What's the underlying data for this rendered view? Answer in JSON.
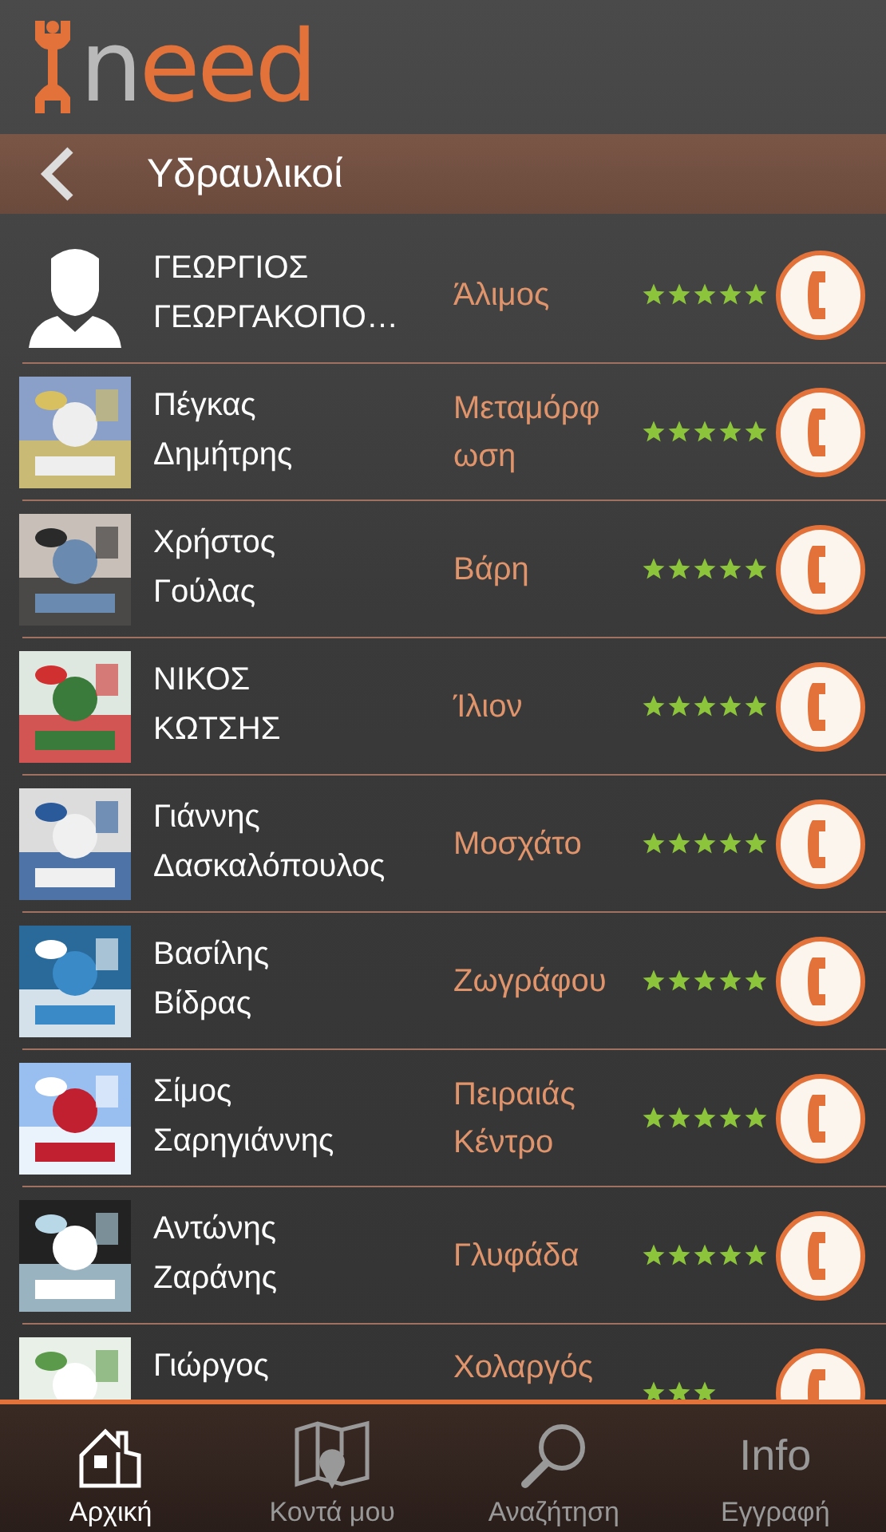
{
  "logo": {
    "text": "need"
  },
  "title_bar": {
    "title": "Υδραυλικοί"
  },
  "rows": [
    {
      "kind": "silhouette",
      "first": "ΓΕΩΡΓΙΟΣ",
      "last": "ΓΕΩΡΓΑΚΟΠΟ…",
      "city": "Άλιμος",
      "stars": 5
    },
    {
      "kind": "picture",
      "first": "Πέγκας",
      "last": "Δημήτρης",
      "city": "Μεταμόρφ ωση",
      "stars": 5
    },
    {
      "kind": "picture",
      "first": "Χρήστος",
      "last": "Γούλας",
      "city": "Βάρη",
      "stars": 5
    },
    {
      "kind": "picture",
      "first": "ΝΙΚΟΣ",
      "last": "ΚΩΤΣΗΣ",
      "city": "Ίλιον",
      "stars": 5
    },
    {
      "kind": "picture",
      "first": "Γιάννης",
      "last": "Δασκαλόπουλος",
      "city": "Μοσχάτο",
      "stars": 5
    },
    {
      "kind": "picture",
      "first": "Βασίλης",
      "last": "Βίδρας",
      "city": "Ζωγράφου",
      "stars": 5
    },
    {
      "kind": "picture",
      "first": "Σίμος",
      "last": "Σαρηγιάννης",
      "city": "Πειραιάς Κέντρο",
      "stars": 5
    },
    {
      "kind": "picture",
      "first": "Αντώνης",
      "last": "Ζαράνης",
      "city": "Γλυφάδα",
      "stars": 5
    },
    {
      "kind": "picture",
      "first": "Γιώργος",
      "city": "Χολαργός",
      "stars": 3
    }
  ],
  "tab_bar": [
    {
      "kind": "home",
      "label": "Αρχική",
      "selected": true
    },
    {
      "kind": "map",
      "label": "Κοντά μου",
      "selected": false
    },
    {
      "kind": "search",
      "label": "Αναζήτηση",
      "selected": false
    },
    {
      "kind": "text",
      "icon_text": "Info",
      "label": "Εγγραφή",
      "selected": false
    }
  ]
}
